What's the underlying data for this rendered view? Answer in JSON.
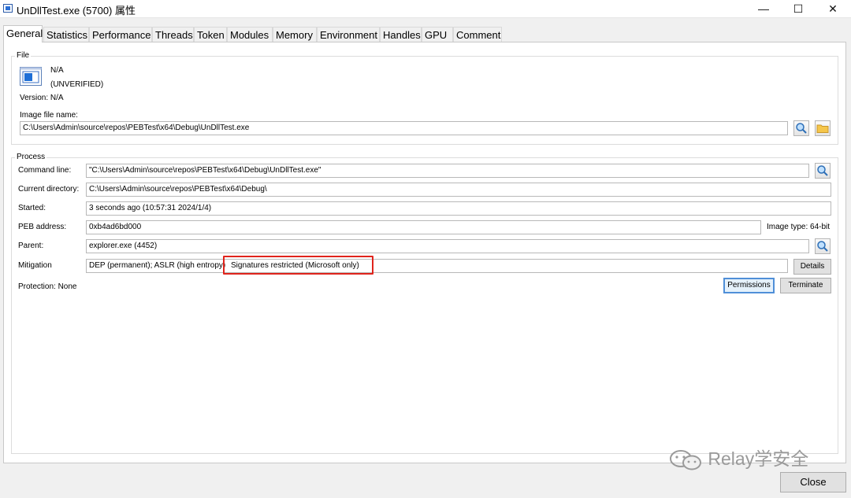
{
  "window": {
    "title": "UnDllTest.exe (5700) 属性",
    "minimize": "—",
    "maximize": "☐",
    "close": "✕"
  },
  "tabs": [
    {
      "label": "General",
      "active": true
    },
    {
      "label": "Statistics"
    },
    {
      "label": "Performance"
    },
    {
      "label": "Threads"
    },
    {
      "label": "Token"
    },
    {
      "label": "Modules"
    },
    {
      "label": "Memory"
    },
    {
      "label": "Environment"
    },
    {
      "label": "Handles"
    },
    {
      "label": "GPU"
    },
    {
      "label": "Comment"
    }
  ],
  "file": {
    "group_label": "File",
    "description": "N/A",
    "company": "(UNVERIFIED)",
    "version": "Version: N/A",
    "image_label": "Image file name:",
    "image_path": "C:\\Users\\Admin\\source\\repos\\PEBTest\\x64\\Debug\\UnDllTest.exe"
  },
  "process": {
    "group_label": "Process",
    "command_line_label": "Command line:",
    "command_line": "\"C:\\Users\\Admin\\source\\repos\\PEBTest\\x64\\Debug\\UnDllTest.exe\"",
    "current_dir_label": "Current directory:",
    "current_dir": "C:\\Users\\Admin\\source\\repos\\PEBTest\\x64\\Debug\\",
    "started_label": "Started:",
    "started": "3 seconds ago (10:57:31 2024/1/4)",
    "peb_label": "PEB address:",
    "peb": "0xb4ad6bd000",
    "image_type": "Image type:  64-bit",
    "parent_label": "Parent:",
    "parent": "explorer.exe (4452)",
    "mitigation_label": "Mitigation",
    "mitigation_a": "DEP (permanent); ASLR (high entropy)",
    "mitigation_b": "Signatures restricted (Microsoft only)",
    "details_button": "Details",
    "protection": "Protection: None",
    "permissions_button": "Permissions",
    "terminate_button": "Terminate"
  },
  "footer": {
    "close_button": "Close",
    "watermark": "Relay学安全"
  },
  "colors": {
    "highlight": "#e0241c",
    "focus_border": "#4f8fd8"
  }
}
